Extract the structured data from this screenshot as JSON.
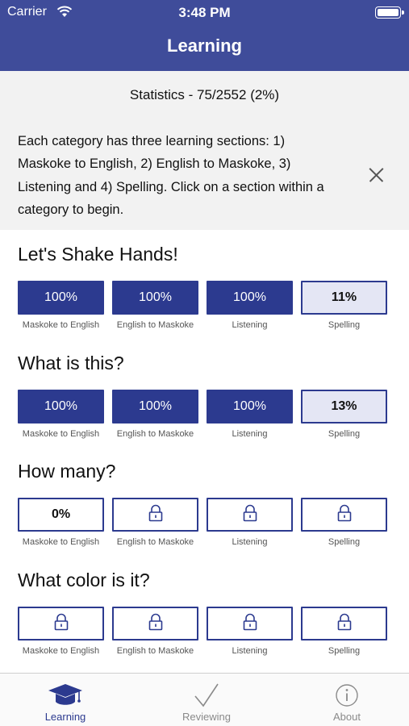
{
  "status_bar": {
    "carrier": "Carrier",
    "time": "3:48 PM"
  },
  "header": {
    "title": "Learning"
  },
  "info": {
    "statistics": "Statistics - 75/2552 (2%)",
    "intro": "Each category has three learning sections: 1) Maskoke to English, 2) English to Maskoke, 3) Listening and 4) Spelling. Click on a section within a category to begin."
  },
  "categories": [
    {
      "title": "Let's Shake Hands!",
      "sections": [
        {
          "label": "Maskoke to English",
          "value": "100%",
          "state": "done"
        },
        {
          "label": "English to Maskoke",
          "value": "100%",
          "state": "done"
        },
        {
          "label": "Listening",
          "value": "100%",
          "state": "done"
        },
        {
          "label": "Spelling",
          "value": "11%",
          "state": "partial"
        }
      ]
    },
    {
      "title": "What is this?",
      "sections": [
        {
          "label": "Maskoke to English",
          "value": "100%",
          "state": "done"
        },
        {
          "label": "English to Maskoke",
          "value": "100%",
          "state": "done"
        },
        {
          "label": "Listening",
          "value": "100%",
          "state": "done"
        },
        {
          "label": "Spelling",
          "value": "13%",
          "state": "partial"
        }
      ]
    },
    {
      "title": "How many?",
      "sections": [
        {
          "label": "Maskoke to English",
          "value": "0%",
          "state": "open"
        },
        {
          "label": "English to Maskoke",
          "value": "",
          "state": "locked"
        },
        {
          "label": "Listening",
          "value": "",
          "state": "locked"
        },
        {
          "label": "Spelling",
          "value": "",
          "state": "locked"
        }
      ]
    },
    {
      "title": "What color is it?",
      "sections": [
        {
          "label": "Maskoke to English",
          "value": "",
          "state": "locked"
        },
        {
          "label": "English to Maskoke",
          "value": "",
          "state": "locked"
        },
        {
          "label": "Listening",
          "value": "",
          "state": "locked"
        },
        {
          "label": "Spelling",
          "value": "",
          "state": "locked"
        }
      ]
    }
  ],
  "tabs": [
    {
      "label": "Learning",
      "icon": "graduation-cap-icon",
      "active": true
    },
    {
      "label": "Reviewing",
      "icon": "checkmark-icon",
      "active": false
    },
    {
      "label": "About",
      "icon": "info-icon",
      "active": false
    }
  ],
  "colors": {
    "brand": "#3f4c9a",
    "completed": "#2c3a8f",
    "partial": "#e4e6f4"
  }
}
